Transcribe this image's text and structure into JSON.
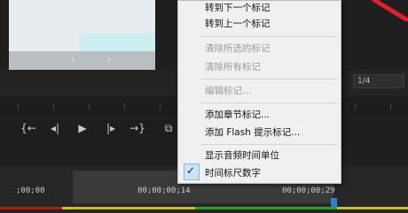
{
  "monitor": {
    "preview_text": "",
    "prev_arrow": "‹",
    "next_arrow": "›",
    "fraction": "1/4"
  },
  "transport": {
    "mark_in": "{←",
    "step_back": "◂|",
    "play": "▶",
    "step_forward": "|▸",
    "mark_out": "→}",
    "export_frame": "⧉"
  },
  "timeline": {
    "tc_start": ";00;00",
    "tc_mid": "00;00;00;14",
    "tc_end": "00;00;00;29"
  },
  "menu": {
    "items": [
      {
        "label": "转到下一个标记",
        "enabled": true
      },
      {
        "label": "转到上一个标记",
        "enabled": true
      },
      {
        "label": "清除所选的标记",
        "enabled": false
      },
      {
        "label": "清除所有标记",
        "enabled": false
      },
      {
        "label": "编辑标记...",
        "enabled": false
      },
      {
        "label": "添加章节标记...",
        "enabled": true
      },
      {
        "label": "添加 Flash 提示标记...",
        "enabled": true
      },
      {
        "label": "显示音频时间单位",
        "enabled": true
      },
      {
        "label": "时间标尺数字",
        "enabled": true,
        "checked": true
      }
    ],
    "check_glyph": "✓"
  },
  "colors": {
    "menu_bg": "#f0f0f0",
    "panel_bg": "#1f1f1f",
    "accent_blue": "#2f7fd6",
    "strip_red": "#b01c1c",
    "strip_yellow": "#c7c21c",
    "strip_green": "#2aa02a"
  }
}
